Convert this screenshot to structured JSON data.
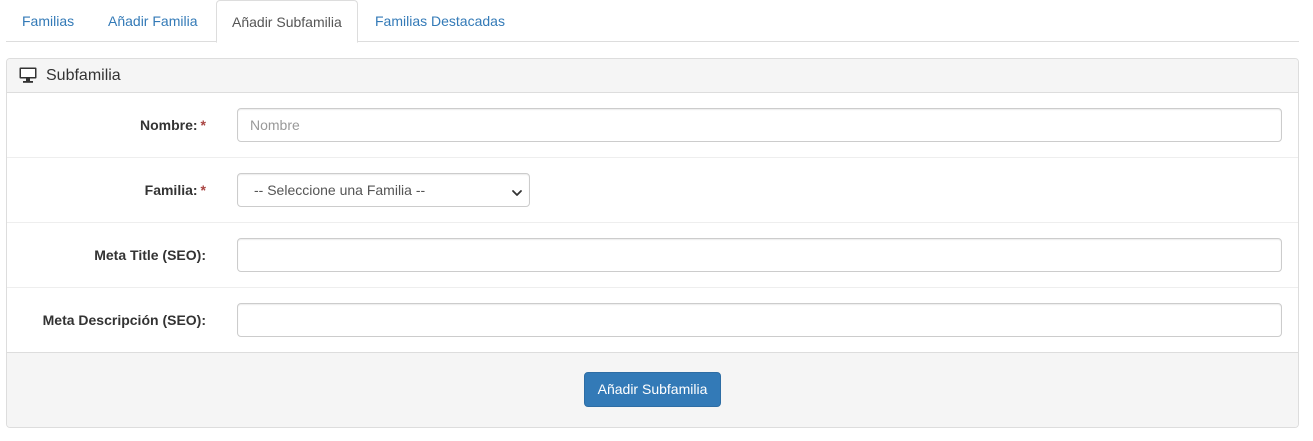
{
  "tabs": [
    {
      "label": "Familias",
      "active": false
    },
    {
      "label": "Añadir Familia",
      "active": false
    },
    {
      "label": "Añadir Subfamilia",
      "active": true
    },
    {
      "label": "Familias Destacadas",
      "active": false
    }
  ],
  "panel": {
    "icon": "monitor-icon",
    "title": "Subfamilia"
  },
  "form": {
    "nombre": {
      "label": "Nombre:",
      "required_mark": "*",
      "placeholder": "Nombre",
      "value": ""
    },
    "familia": {
      "label": "Familia:",
      "required_mark": "*",
      "selected": "-- Seleccione una Familia --"
    },
    "meta_title": {
      "label": "Meta Title (SEO):",
      "value": ""
    },
    "meta_descripcion": {
      "label": "Meta Descripción (SEO):",
      "value": ""
    }
  },
  "footer": {
    "submit_label": "Añadir Subfamilia"
  },
  "colors": {
    "link": "#337ab7",
    "button": "#337ab7",
    "required": "#a94442",
    "panel_bg": "#f5f5f5"
  }
}
